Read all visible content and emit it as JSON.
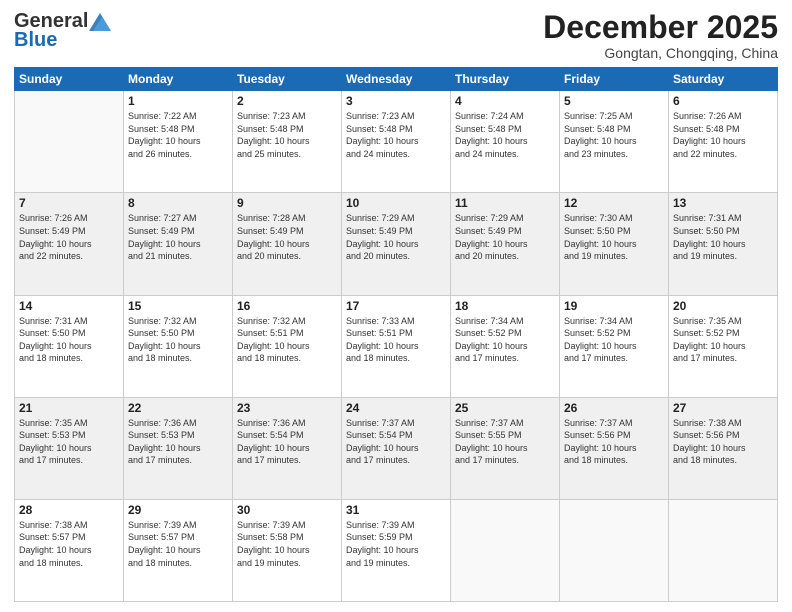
{
  "header": {
    "logo_general": "General",
    "logo_blue": "Blue",
    "month_title": "December 2025",
    "location": "Gongtan, Chongqing, China"
  },
  "days_of_week": [
    "Sunday",
    "Monday",
    "Tuesday",
    "Wednesday",
    "Thursday",
    "Friday",
    "Saturday"
  ],
  "weeks": [
    [
      {
        "day": "",
        "info": ""
      },
      {
        "day": "1",
        "info": "Sunrise: 7:22 AM\nSunset: 5:48 PM\nDaylight: 10 hours\nand 26 minutes."
      },
      {
        "day": "2",
        "info": "Sunrise: 7:23 AM\nSunset: 5:48 PM\nDaylight: 10 hours\nand 25 minutes."
      },
      {
        "day": "3",
        "info": "Sunrise: 7:23 AM\nSunset: 5:48 PM\nDaylight: 10 hours\nand 24 minutes."
      },
      {
        "day": "4",
        "info": "Sunrise: 7:24 AM\nSunset: 5:48 PM\nDaylight: 10 hours\nand 24 minutes."
      },
      {
        "day": "5",
        "info": "Sunrise: 7:25 AM\nSunset: 5:48 PM\nDaylight: 10 hours\nand 23 minutes."
      },
      {
        "day": "6",
        "info": "Sunrise: 7:26 AM\nSunset: 5:48 PM\nDaylight: 10 hours\nand 22 minutes."
      }
    ],
    [
      {
        "day": "7",
        "info": "Sunrise: 7:26 AM\nSunset: 5:49 PM\nDaylight: 10 hours\nand 22 minutes."
      },
      {
        "day": "8",
        "info": "Sunrise: 7:27 AM\nSunset: 5:49 PM\nDaylight: 10 hours\nand 21 minutes."
      },
      {
        "day": "9",
        "info": "Sunrise: 7:28 AM\nSunset: 5:49 PM\nDaylight: 10 hours\nand 20 minutes."
      },
      {
        "day": "10",
        "info": "Sunrise: 7:29 AM\nSunset: 5:49 PM\nDaylight: 10 hours\nand 20 minutes."
      },
      {
        "day": "11",
        "info": "Sunrise: 7:29 AM\nSunset: 5:49 PM\nDaylight: 10 hours\nand 20 minutes."
      },
      {
        "day": "12",
        "info": "Sunrise: 7:30 AM\nSunset: 5:50 PM\nDaylight: 10 hours\nand 19 minutes."
      },
      {
        "day": "13",
        "info": "Sunrise: 7:31 AM\nSunset: 5:50 PM\nDaylight: 10 hours\nand 19 minutes."
      }
    ],
    [
      {
        "day": "14",
        "info": "Sunrise: 7:31 AM\nSunset: 5:50 PM\nDaylight: 10 hours\nand 18 minutes."
      },
      {
        "day": "15",
        "info": "Sunrise: 7:32 AM\nSunset: 5:50 PM\nDaylight: 10 hours\nand 18 minutes."
      },
      {
        "day": "16",
        "info": "Sunrise: 7:32 AM\nSunset: 5:51 PM\nDaylight: 10 hours\nand 18 minutes."
      },
      {
        "day": "17",
        "info": "Sunrise: 7:33 AM\nSunset: 5:51 PM\nDaylight: 10 hours\nand 18 minutes."
      },
      {
        "day": "18",
        "info": "Sunrise: 7:34 AM\nSunset: 5:52 PM\nDaylight: 10 hours\nand 17 minutes."
      },
      {
        "day": "19",
        "info": "Sunrise: 7:34 AM\nSunset: 5:52 PM\nDaylight: 10 hours\nand 17 minutes."
      },
      {
        "day": "20",
        "info": "Sunrise: 7:35 AM\nSunset: 5:52 PM\nDaylight: 10 hours\nand 17 minutes."
      }
    ],
    [
      {
        "day": "21",
        "info": "Sunrise: 7:35 AM\nSunset: 5:53 PM\nDaylight: 10 hours\nand 17 minutes."
      },
      {
        "day": "22",
        "info": "Sunrise: 7:36 AM\nSunset: 5:53 PM\nDaylight: 10 hours\nand 17 minutes."
      },
      {
        "day": "23",
        "info": "Sunrise: 7:36 AM\nSunset: 5:54 PM\nDaylight: 10 hours\nand 17 minutes."
      },
      {
        "day": "24",
        "info": "Sunrise: 7:37 AM\nSunset: 5:54 PM\nDaylight: 10 hours\nand 17 minutes."
      },
      {
        "day": "25",
        "info": "Sunrise: 7:37 AM\nSunset: 5:55 PM\nDaylight: 10 hours\nand 17 minutes."
      },
      {
        "day": "26",
        "info": "Sunrise: 7:37 AM\nSunset: 5:56 PM\nDaylight: 10 hours\nand 18 minutes."
      },
      {
        "day": "27",
        "info": "Sunrise: 7:38 AM\nSunset: 5:56 PM\nDaylight: 10 hours\nand 18 minutes."
      }
    ],
    [
      {
        "day": "28",
        "info": "Sunrise: 7:38 AM\nSunset: 5:57 PM\nDaylight: 10 hours\nand 18 minutes."
      },
      {
        "day": "29",
        "info": "Sunrise: 7:39 AM\nSunset: 5:57 PM\nDaylight: 10 hours\nand 18 minutes."
      },
      {
        "day": "30",
        "info": "Sunrise: 7:39 AM\nSunset: 5:58 PM\nDaylight: 10 hours\nand 19 minutes."
      },
      {
        "day": "31",
        "info": "Sunrise: 7:39 AM\nSunset: 5:59 PM\nDaylight: 10 hours\nand 19 minutes."
      },
      {
        "day": "",
        "info": ""
      },
      {
        "day": "",
        "info": ""
      },
      {
        "day": "",
        "info": ""
      }
    ]
  ]
}
